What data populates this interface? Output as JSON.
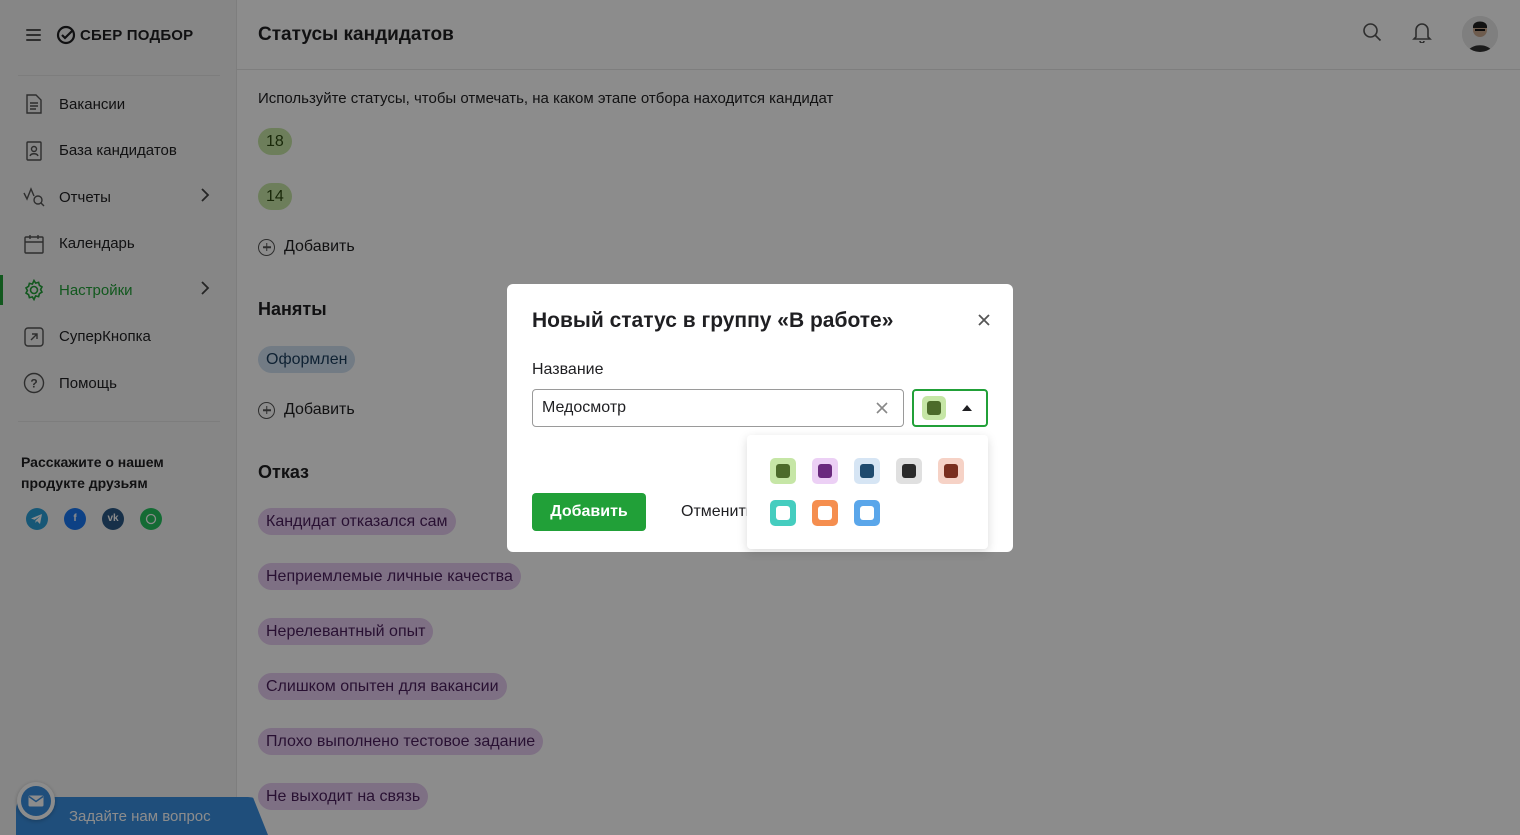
{
  "app": {
    "logo_text": "СБЕР ПОДБОР"
  },
  "sidebar": {
    "items": [
      {
        "label": "Вакансии"
      },
      {
        "label": "База кандидатов"
      },
      {
        "label": "Отчеты"
      },
      {
        "label": "Календарь"
      },
      {
        "label": "Настройки"
      },
      {
        "label": "СуперКнопка"
      },
      {
        "label": "Помощь"
      }
    ],
    "share_text": "Расскажите о нашем продукте друзьям",
    "ask_button": "Задайте нам вопрос"
  },
  "header": {
    "title": "Статусы кандидатов"
  },
  "main": {
    "description": "Используйте статусы, чтобы отмечать, на каком этапе отбора находится кандидат",
    "in_work_statuses": [
      "18",
      "14"
    ],
    "add_label": "Добавить",
    "hired_group": {
      "title": "Наняты",
      "statuses": [
        "Оформлен"
      ]
    },
    "rejected_group": {
      "title": "Отказ",
      "statuses": [
        "Кандидат отказался сам",
        "Неприемлемые личные качества",
        "Нерелевантный опыт",
        "Слишком опытен для вакансии",
        "Плохо выполнено тестовое задание",
        "Не выходит на связь"
      ]
    }
  },
  "modal": {
    "title": "Новый статус в группу «В работе»",
    "field_label": "Название",
    "name_value": "Медосмотр",
    "add_button": "Добавить",
    "cancel_button": "Отменить"
  },
  "colors": {
    "accent": "#21a038",
    "palette": [
      {
        "bg": "#c6e6a6",
        "fg": "#4c6b2a"
      },
      {
        "bg": "#ecd0f5",
        "fg": "#6a2a7e"
      },
      {
        "bg": "#d6e5f4",
        "fg": "#1e4a6e"
      },
      {
        "bg": "#e0e0e0",
        "fg": "#2b2b2b"
      },
      {
        "bg": "#f6d2c6",
        "fg": "#7a2e1e"
      },
      {
        "bg": "#45cdbf",
        "fg": "#ffffff"
      },
      {
        "bg": "#f58e4f",
        "fg": "#ffffff"
      },
      {
        "bg": "#5aa6ea",
        "fg": "#ffffff"
      }
    ]
  }
}
